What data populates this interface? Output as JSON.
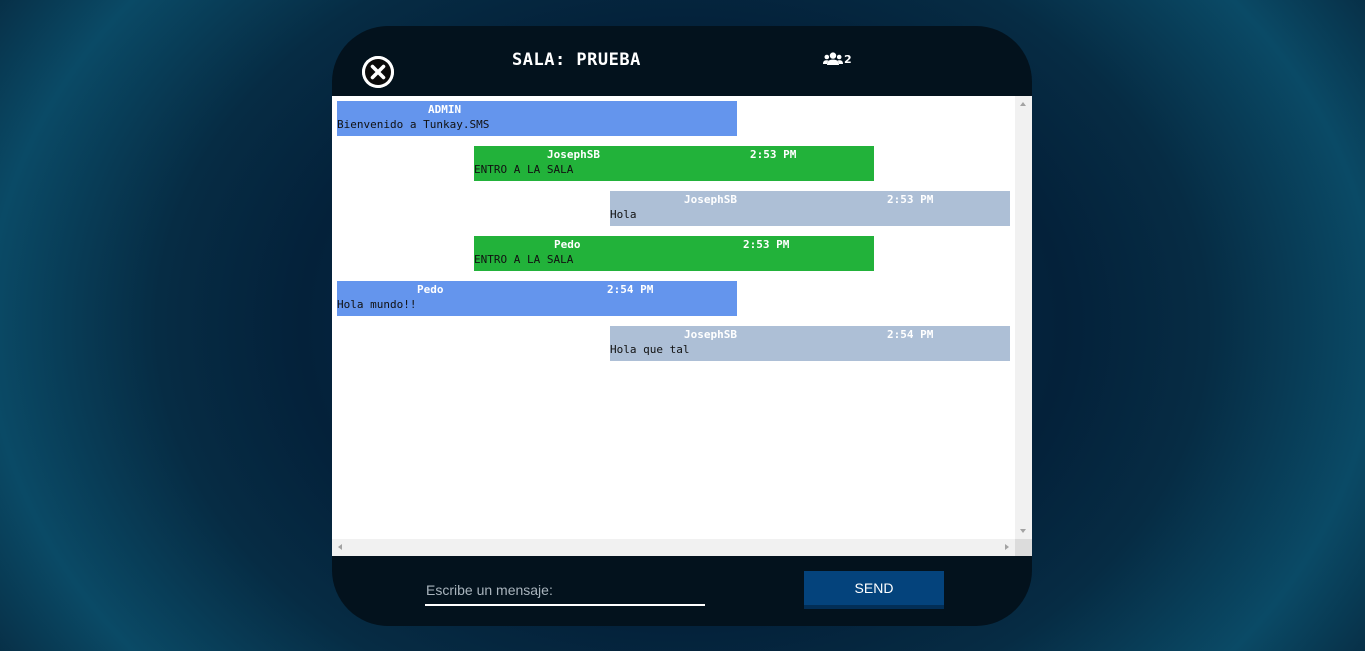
{
  "header": {
    "room_title": "SALA: PRUEBA",
    "close_icon": "close-icon",
    "users_icon": "users-icon",
    "users_count": "2"
  },
  "messages": [
    {
      "author": "ADMIN",
      "time": "",
      "text": "Bienvenido a Tunkay.SMS",
      "color": "#6495ed"
    },
    {
      "author": "JosephSB",
      "time": "2:53 PM",
      "text": "ENTRO A LA SALA",
      "color": "#22b23a"
    },
    {
      "author": "JosephSB",
      "time": "2:53 PM",
      "text": "Hola",
      "color": "#adbfd6"
    },
    {
      "author": "Pedo",
      "time": "2:53 PM",
      "text": "ENTRO A LA SALA",
      "color": "#22b23a"
    },
    {
      "author": "Pedo",
      "time": "2:54 PM",
      "text": "Hola mundo!!",
      "color": "#6495ed"
    },
    {
      "author": "JosephSB",
      "time": "2:54 PM",
      "text": "Hola que tal",
      "color": "#adbfd6"
    }
  ],
  "composer": {
    "placeholder": "Escribe un mensaje:",
    "value": "",
    "send_label": "SEND"
  },
  "colors": {
    "panel": "#03121d",
    "send_button": "#04437c"
  }
}
